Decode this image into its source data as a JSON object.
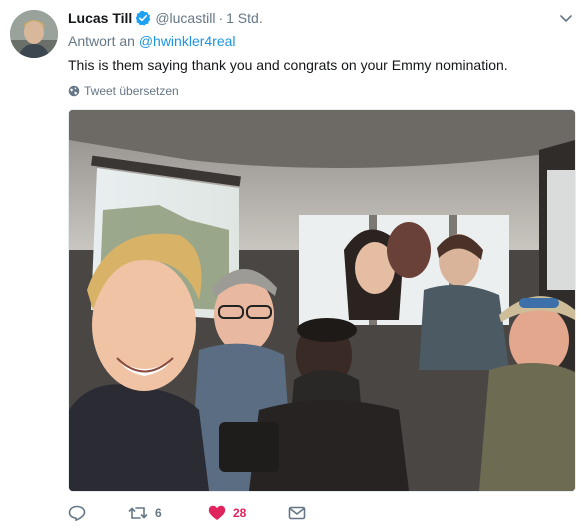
{
  "tweet": {
    "author_name": "Lucas Till",
    "author_handle": "@lucastill",
    "separator": "·",
    "time_ago": "1 Std.",
    "reply_prefix": "Antwort an",
    "reply_mention": "@hwinkler4real",
    "text": "This is them saying thank you and congrats on your Emmy nomination.",
    "translate_label": "Tweet übersetzen",
    "retweet_count": "6",
    "like_count": "28"
  },
  "icons": {
    "verified": "verified-badge-icon",
    "caret": "chevron-down-icon",
    "globe": "globe-icon",
    "reply": "reply-icon",
    "retweet": "retweet-icon",
    "like": "heart-icon",
    "dm": "envelope-icon"
  },
  "colors": {
    "text": "#14171a",
    "secondary": "#657786",
    "link": "#1b95e0",
    "verified": "#1da1f2",
    "like": "#e0245e"
  }
}
